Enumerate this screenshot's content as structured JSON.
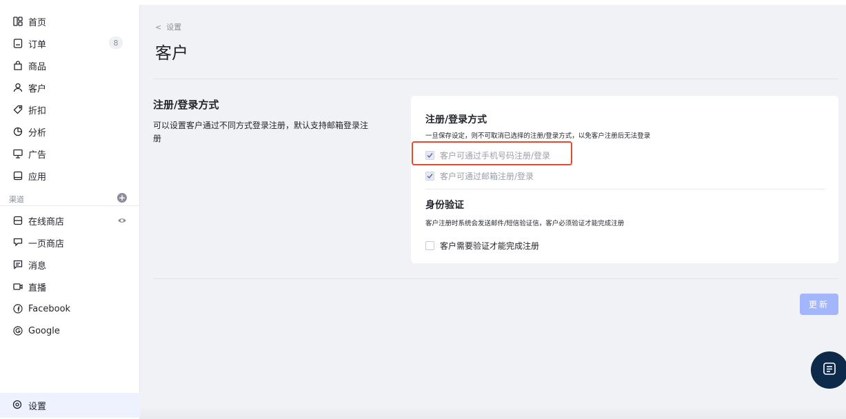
{
  "sidebar": {
    "items": [
      {
        "label": "首页",
        "icon": "dashboard-icon"
      },
      {
        "label": "订单",
        "icon": "orders-icon",
        "badge": "8"
      },
      {
        "label": "商品",
        "icon": "bag-icon"
      },
      {
        "label": "客户",
        "icon": "user-icon"
      },
      {
        "label": "折扣",
        "icon": "tag-icon"
      },
      {
        "label": "分析",
        "icon": "chart-pie-icon"
      },
      {
        "label": "广告",
        "icon": "ad-icon"
      },
      {
        "label": "应用",
        "icon": "app-icon"
      }
    ],
    "channels_label": "渠道",
    "channels": [
      {
        "label": "在线商店",
        "icon": "store-icon"
      },
      {
        "label": "一页商店",
        "icon": "one-page-icon"
      },
      {
        "label": "消息",
        "icon": "message-icon"
      },
      {
        "label": "直播",
        "icon": "live-icon"
      },
      {
        "label": "Facebook",
        "icon": "facebook-icon"
      },
      {
        "label": "Google",
        "icon": "google-icon"
      }
    ],
    "settings_label": "设置"
  },
  "header": {
    "breadcrumb": "设置",
    "title": "客户"
  },
  "section": {
    "title": "注册/登录方式",
    "description": "可以设置客户通过不同方式登录注册，默认支持邮箱登录注册"
  },
  "card": {
    "login_title": "注册/登录方式",
    "login_desc": "一旦保存设定，则不可取消已选择的注册/登录方式，以免客户注册后无法登录",
    "options": [
      {
        "label": "客户可通过手机号码注册/登录",
        "checked": true
      },
      {
        "label": "客户可通过邮箱注册/登录",
        "checked": true
      }
    ],
    "verify_title": "身份验证",
    "verify_desc": "客户注册时系统会发送邮件/短信验证信，客户必须验证才能完成注册",
    "verify_option": {
      "label": "客户需要验证才能完成注册",
      "checked": false
    }
  },
  "actions": {
    "update_label": "更新"
  },
  "colors": {
    "accent": "#a3b6fb",
    "highlight": "#e8462f",
    "chat_bg": "#0d2a4a"
  }
}
